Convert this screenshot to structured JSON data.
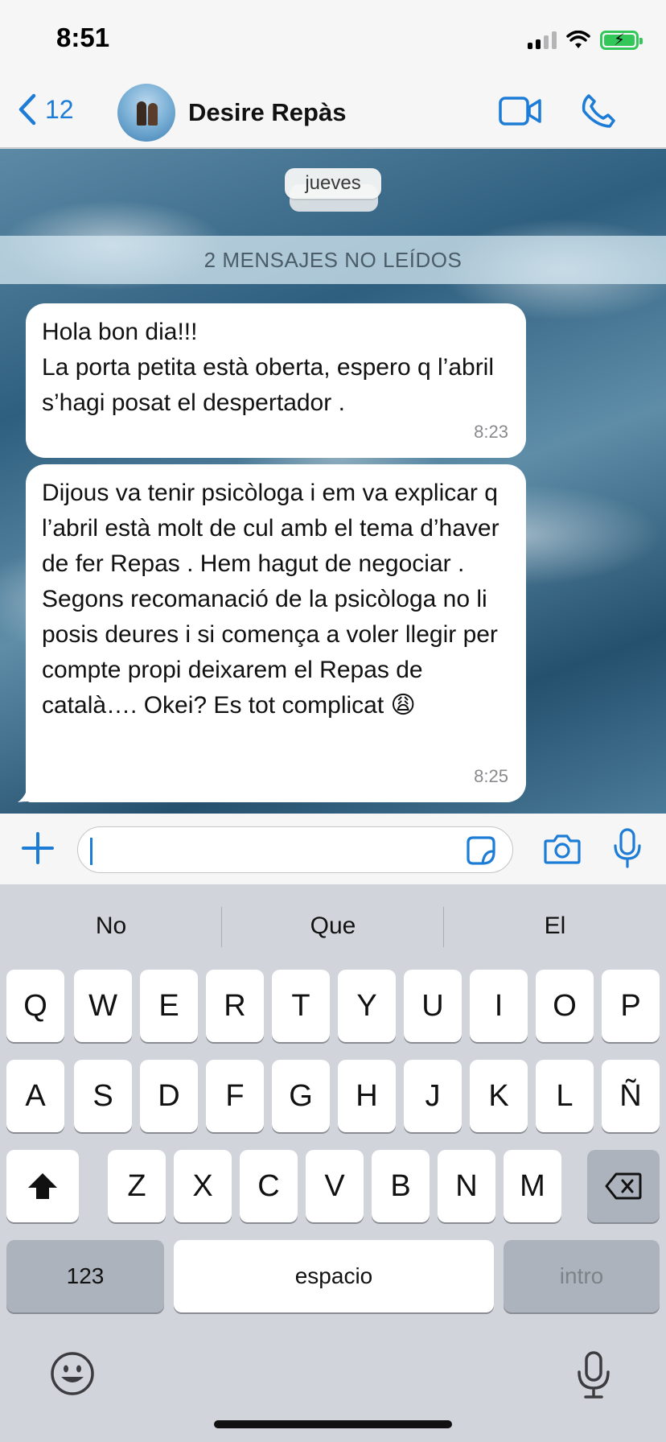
{
  "status_bar": {
    "time": "8:51"
  },
  "header": {
    "back_count": "12",
    "contact_name": "Desire Repàs",
    "accent_color": "#1c7cd6"
  },
  "chat": {
    "date_pill": "jueves",
    "unread_banner": "2 MENSAJES NO LEÍDOS",
    "messages": [
      {
        "text": "Hola bon dia!!!\nLa porta petita està oberta, espero q l’abril s’hagi posat el despertador .",
        "time": "8:23"
      },
      {
        "text": "Dijous va tenir psicòloga i em va explicar q l’abril està molt de cul amb el tema d’haver de fer Repas . Hem hagut de negociar . Segons recomanació de la psicòloga no li posis deures i si comença a voler llegir per compte propi deixarem el Repas de català…. Okei? Es tot complicat 😩",
        "time": "8:25"
      }
    ]
  },
  "input": {
    "value": "",
    "placeholder": ""
  },
  "keyboard": {
    "suggestions": [
      "No",
      "Que",
      "El"
    ],
    "row1": [
      "Q",
      "W",
      "E",
      "R",
      "T",
      "Y",
      "U",
      "I",
      "O",
      "P"
    ],
    "row2": [
      "A",
      "S",
      "D",
      "F",
      "G",
      "H",
      "J",
      "K",
      "L",
      "Ñ"
    ],
    "row3": [
      "Z",
      "X",
      "C",
      "V",
      "B",
      "N",
      "M"
    ],
    "numbers_label": "123",
    "space_label": "espacio",
    "return_label": "intro"
  },
  "icons": {
    "back": "chevron-left-icon",
    "video": "video-camera-icon",
    "call": "phone-icon",
    "plus": "plus-icon",
    "sticker": "sticker-icon",
    "camera": "camera-icon",
    "mic": "microphone-icon",
    "shift": "shift-icon",
    "delete": "delete-icon",
    "emoji": "emoji-icon",
    "dictation": "dictation-mic-icon"
  }
}
